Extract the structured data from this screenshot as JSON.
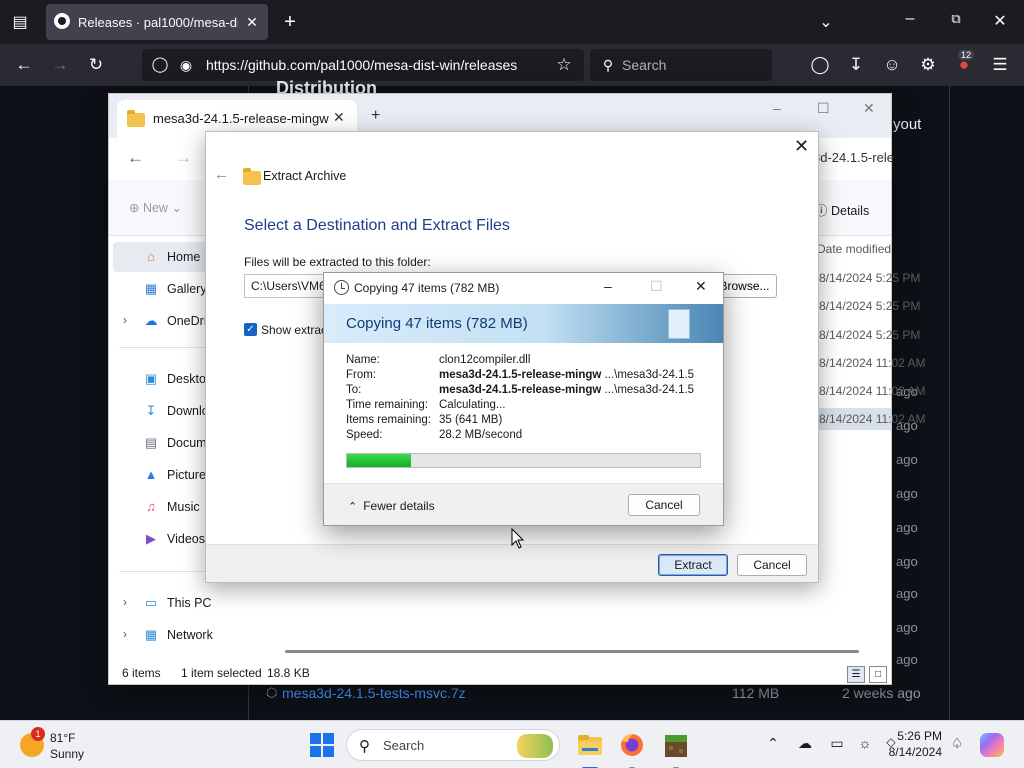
{
  "browser": {
    "tab_title": "Releases · pal1000/mesa-dist-win",
    "url": "https://github.com/pal1000/mesa-dist-win/releases",
    "search_placeholder": "Search",
    "extensions_badge": "12"
  },
  "github": {
    "heading": "Distribution",
    "right_fragment": "yout",
    "relative_dates": [
      "ago",
      "ago",
      "ago",
      "ago",
      "ago",
      "ago",
      "ago",
      "ago",
      "ago"
    ],
    "asset": {
      "name": "mesa3d-24.1.5-tests-msvc.7z",
      "size": "112 MB",
      "date": "2 weeks ago"
    }
  },
  "explorer": {
    "tab_title": "mesa3d-24.1.5-release-mingw",
    "breadcrumb_fragment": "3d-24.1.5-rele",
    "new_label": "New",
    "details_label": "Details",
    "column_header": "Date modified",
    "dates": [
      "8/14/2024 5:25 PM",
      "8/14/2024 5:25 PM",
      "8/14/2024 5:25 PM",
      "8/14/2024 11:02 AM",
      "8/14/2024 11:02 AM",
      "8/14/2024 11:02 AM"
    ],
    "sidebar": {
      "home": "Home",
      "gallery": "Gallery",
      "onedrive": "OneDrive",
      "desktop": "Desktop",
      "downloads": "Downloads",
      "documents": "Documents",
      "pictures": "Pictures",
      "music": "Music",
      "videos": "Videos",
      "this_pc": "This PC",
      "network": "Network"
    },
    "status": {
      "items": "6 items",
      "selected": "1 item selected",
      "size": "18.8 KB"
    }
  },
  "extract_dialog": {
    "header": "Extract Archive",
    "title": "Select a Destination and Extract Files",
    "folder_label": "Files will be extracted to this folder:",
    "path": "C:\\Users\\VM6",
    "browse_label": "Browse...",
    "show_label": "Show extracted files when complete",
    "show_checked": true,
    "extract_label": "Extract",
    "cancel_label": "Cancel"
  },
  "copy_dialog": {
    "window_title": "Copying 47 items (782 MB)",
    "banner_title": "Copying 47 items (782 MB)",
    "details": {
      "name_label": "Name:",
      "name_value": "clon12compiler.dll",
      "from_label": "From:",
      "from_bold": "mesa3d-24.1.5-release-mingw",
      "from_rest": " ...\\mesa3d-24.1.5",
      "to_label": "To:",
      "to_bold": "mesa3d-24.1.5-release-mingw",
      "to_rest": " ...\\mesa3d-24.1.5",
      "time_label": "Time remaining:",
      "time_value": "Calculating...",
      "items_label": "Items remaining:",
      "items_value": "35 (641 MB)",
      "speed_label": "Speed:",
      "speed_value": "28.2 MB/second"
    },
    "progress_fraction": 0.18,
    "fewer_details_label": "Fewer details",
    "cancel_label": "Cancel"
  },
  "taskbar": {
    "weather_temp": "81°F",
    "weather_condition": "Sunny",
    "weather_badge": "1",
    "search_placeholder": "Search",
    "time": "5:26 PM",
    "date": "8/14/2024"
  },
  "colors": {
    "progress_green": "#11b025",
    "accent_blue": "#1a73e8",
    "banner_title": "#123a73",
    "github_link": "#4493f8"
  }
}
